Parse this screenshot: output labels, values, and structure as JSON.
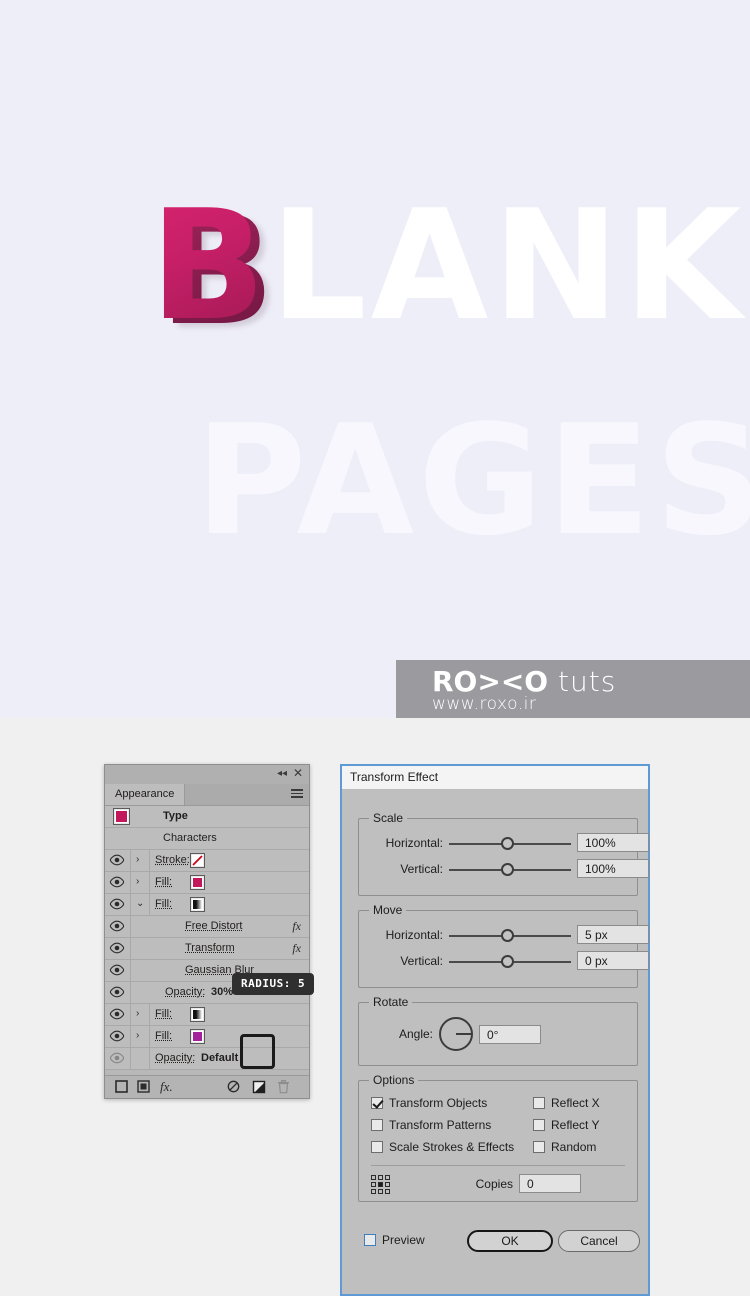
{
  "artwork": {
    "headline_first": "B",
    "headline_rest": "LANK",
    "headline_full": "BLANK",
    "headline_second": "PAGES",
    "background_color": "#eeeef9",
    "accent_color": "#c61f68"
  },
  "watermark": {
    "brand_bold": "RO><O",
    "brand_light": " tuts",
    "url": "www.roxo.ir",
    "background_color": "#9a9a9f"
  },
  "appearance_panel": {
    "tab_label": "Appearance",
    "collapse_icon": "◂◂",
    "close_icon": "✕",
    "menu_icon": "hamburger-icon",
    "rows": [
      {
        "label": "Type",
        "kind": "object",
        "swatch": "magenta",
        "eye": false,
        "chevron": "",
        "fx": false,
        "indent": 0
      },
      {
        "label": "Characters",
        "kind": "group",
        "swatch": "",
        "eye": false,
        "chevron": "",
        "fx": false,
        "indent": 0
      },
      {
        "label": "Stroke:",
        "kind": "stroke",
        "swatch": "none",
        "eye": true,
        "chevron": "›",
        "fx": false,
        "indent": 1
      },
      {
        "label": "Fill:",
        "kind": "fill",
        "swatch": "magenta",
        "eye": true,
        "chevron": "›",
        "fx": false,
        "indent": 1
      },
      {
        "label": "Fill:",
        "kind": "fill",
        "swatch": "gradient",
        "eye": true,
        "chevron": "⌄",
        "fx": false,
        "indent": 1
      },
      {
        "label": "Free Distort",
        "kind": "effect",
        "swatch": "",
        "eye": true,
        "chevron": "",
        "fx": true,
        "indent": 2
      },
      {
        "label": "Transform",
        "kind": "effect",
        "swatch": "",
        "eye": true,
        "chevron": "",
        "fx": true,
        "indent": 2
      },
      {
        "label": "Gaussian Blur",
        "kind": "effect",
        "swatch": "",
        "eye": true,
        "chevron": "",
        "fx": false,
        "indent": 2
      },
      {
        "label": "Opacity:",
        "kind": "opacity",
        "value": "30%",
        "eye": true,
        "chevron": "",
        "fx": false,
        "indent": 2
      },
      {
        "label": "Fill:",
        "kind": "fill",
        "swatch": "gradient",
        "eye": true,
        "chevron": "›",
        "fx": false,
        "indent": 1
      },
      {
        "label": "Fill:",
        "kind": "fill",
        "swatch": "purple",
        "eye": true,
        "chevron": "›",
        "fx": false,
        "indent": 1
      },
      {
        "label": "Opacity:",
        "kind": "opacity",
        "value": "Default",
        "eye": "dim",
        "chevron": "",
        "fx": false,
        "indent": 1
      }
    ],
    "footer_icons": [
      "add-new-stroke-icon",
      "add-new-fill-icon",
      "add-new-effect-icon",
      "clear-appearance-icon",
      "duplicate-selected-item-icon",
      "delete-selected-item-icon"
    ],
    "footer_fx_label": "fx."
  },
  "tooltip": {
    "text": "RADIUS: 5",
    "background_color": "#2f2f2f"
  },
  "dialog": {
    "title": "Transform Effect",
    "border_color": "#5f9ad4",
    "scale": {
      "legend": "Scale",
      "horizontal_label": "Horizontal:",
      "horizontal_value": "100%",
      "vertical_label": "Vertical:",
      "vertical_value": "100%"
    },
    "move": {
      "legend": "Move",
      "horizontal_label": "Horizontal:",
      "horizontal_value": "5 px",
      "vertical_label": "Vertical:",
      "vertical_value": "0 px"
    },
    "rotate": {
      "legend": "Rotate",
      "angle_label": "Angle:",
      "angle_value": "0°"
    },
    "options": {
      "legend": "Options",
      "checkboxes": [
        {
          "label": "Transform Objects",
          "checked": true
        },
        {
          "label": "Transform Patterns",
          "checked": false
        },
        {
          "label": "Scale Strokes & Effects",
          "checked": false
        },
        {
          "label": "Reflect X",
          "checked": false
        },
        {
          "label": "Reflect Y",
          "checked": false
        },
        {
          "label": "Random",
          "checked": false
        }
      ],
      "copies_label": "Copies",
      "copies_value": "0",
      "anchor_icon": "anchor-point-grid-icon"
    },
    "footer": {
      "preview_label": "Preview",
      "preview_checked": false,
      "ok_label": "OK",
      "cancel_label": "Cancel"
    }
  }
}
